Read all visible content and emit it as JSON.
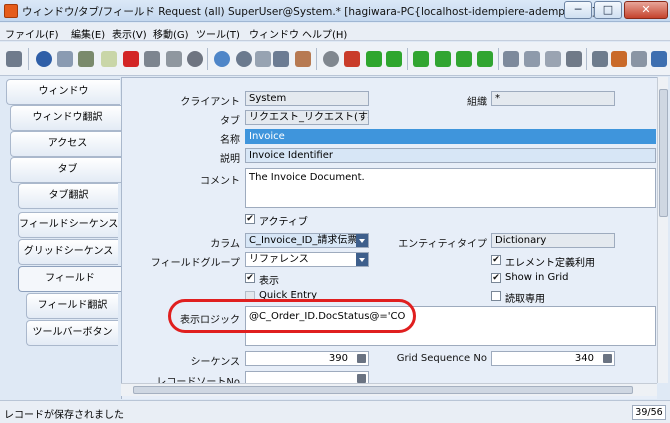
{
  "window": {
    "title": "ウィンドウ/タブ/フィールド  Request (all)  SuperUser@System.* [hagiwara-PC{localhost-idempiere-adempiere}]",
    "min": "─",
    "max": "□",
    "close": "✕"
  },
  "menu": [
    "ファイル(F)",
    "編集(E)",
    "表示(V)",
    "移動(G)",
    "ツール(T)",
    "ウィンドウ",
    "ヘルプ(H)"
  ],
  "tabs": [
    "ウィンドウ",
    "ウィンドウ翻訳",
    "アクセス",
    "タブ",
    "タブ翻訳",
    "フィールドシーケンス",
    "グリッドシーケンス",
    "フィールド",
    "フィールド翻訳",
    "ツールバーボタン"
  ],
  "form": {
    "client_label": "クライアント",
    "client_value": "System",
    "org_label": "組織",
    "org_value": "*",
    "tab_label": "タブ",
    "tab_value": "リクエスト_リクエスト(すべて",
    "name_label": "名称",
    "name_value": "Invoice",
    "desc_label": "説明",
    "desc_value": "Invoice Identifier",
    "comment_label": "コメント",
    "comment_value": "The Invoice Document.",
    "active_label": "アクティブ",
    "column_label": "カラム",
    "column_value": "C_Invoice_ID_請求伝票",
    "entity_label": "エンティティタイプ",
    "entity_value": "Dictionary",
    "fieldgroup_label": "フィールドグループ",
    "fieldgroup_value": "リファレンス",
    "centrally_label": "エレメント定義利用",
    "displayed_label": "表示",
    "showgrid_label": "Show in Grid",
    "quickentry_label": "Quick Entry",
    "readonly_label": "読取専用",
    "displaylogic_label": "表示ロジック",
    "displaylogic_value": "@C_Order_ID.DocStatus@='CO",
    "seq_label": "シーケンス",
    "seq_value": "390",
    "gridseq_label": "Grid Sequence No",
    "gridseq_value": "340",
    "sortno_label": "レコードソートNo"
  },
  "status": {
    "message": "レコードが保存されました",
    "record_count": "39/56"
  },
  "colors": {
    "accent": "#3f95dc",
    "highlight_ring": "#e01f1f",
    "titlebar": "#c4d8ef"
  }
}
